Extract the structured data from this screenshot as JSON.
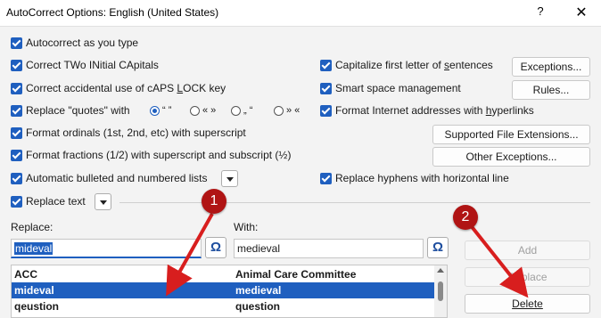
{
  "window": {
    "title": "AutoCorrect Options: English (United States)",
    "help_glyph": "?",
    "close_glyph": "✕"
  },
  "options_left": [
    {
      "label_pre": "",
      "label_u": "",
      "label_post": "Autocorrect as you type",
      "checked": true
    },
    {
      "label_pre": "Correct TWo INitial CApitals",
      "label_u": "",
      "label_post": "",
      "checked": true
    },
    {
      "label_pre": "Correct accidental use of cAPS ",
      "label_u": "L",
      "label_post": "OCK key",
      "checked": true
    },
    {
      "label_pre": "Replace \"quotes\" with",
      "label_u": "",
      "label_post": "",
      "checked": true
    },
    {
      "label_pre": "Format ordinals (1st, 2nd, etc) with superscript",
      "label_u": "",
      "label_post": "",
      "checked": true
    },
    {
      "label_pre": "Format fractions (1/2) with superscript and subscript (½)",
      "label_u": "",
      "label_post": "",
      "checked": true
    },
    {
      "label_pre": "Automatic bulleted and numbered lists",
      "label_u": "",
      "label_post": "",
      "checked": true
    },
    {
      "label_pre": "Replace text",
      "label_u": "",
      "label_post": "",
      "checked": true
    }
  ],
  "quote_styles": [
    {
      "label": "“ ”",
      "selected": true
    },
    {
      "label": "« »",
      "selected": false
    },
    {
      "label": "„ “",
      "selected": false
    },
    {
      "label": "» «",
      "selected": false
    }
  ],
  "options_right": [
    {
      "label_pre": "Capitalize first letter of ",
      "label_u": "s",
      "label_post": "entences",
      "checked": true
    },
    {
      "label_pre": "Smart space management",
      "label_u": "",
      "label_post": "",
      "checked": true
    },
    {
      "label_pre": "Format Internet addresses with ",
      "label_u": "h",
      "label_post": "yperlinks",
      "checked": true
    },
    {
      "label_pre": "Replace hyphens with horizontal line",
      "label_u": "",
      "label_post": "",
      "checked": true
    }
  ],
  "buttons": {
    "exceptions": "Exceptions...",
    "rules": "Rules...",
    "supported_ext": "Supported File Extensions...",
    "other_exceptions": "Other Exceptions...",
    "add": "Add",
    "replace": "Replace",
    "delete": "Delete"
  },
  "replace_section": {
    "replace_label": "Replace:",
    "with_label": "With:",
    "replace_value": "mideval",
    "with_value": "medieval",
    "omega_glyph": "Ω"
  },
  "entries": [
    {
      "replace": "ACC",
      "with": "Animal Care Committee",
      "selected": false
    },
    {
      "replace": "mideval",
      "with": "medieval",
      "selected": true
    },
    {
      "replace": "qeustion",
      "with": "question",
      "selected": false
    }
  ],
  "annotations": {
    "marker_1": "1",
    "marker_2": "2",
    "color": "#b01414"
  },
  "colors": {
    "accent": "#1f5fbf"
  }
}
